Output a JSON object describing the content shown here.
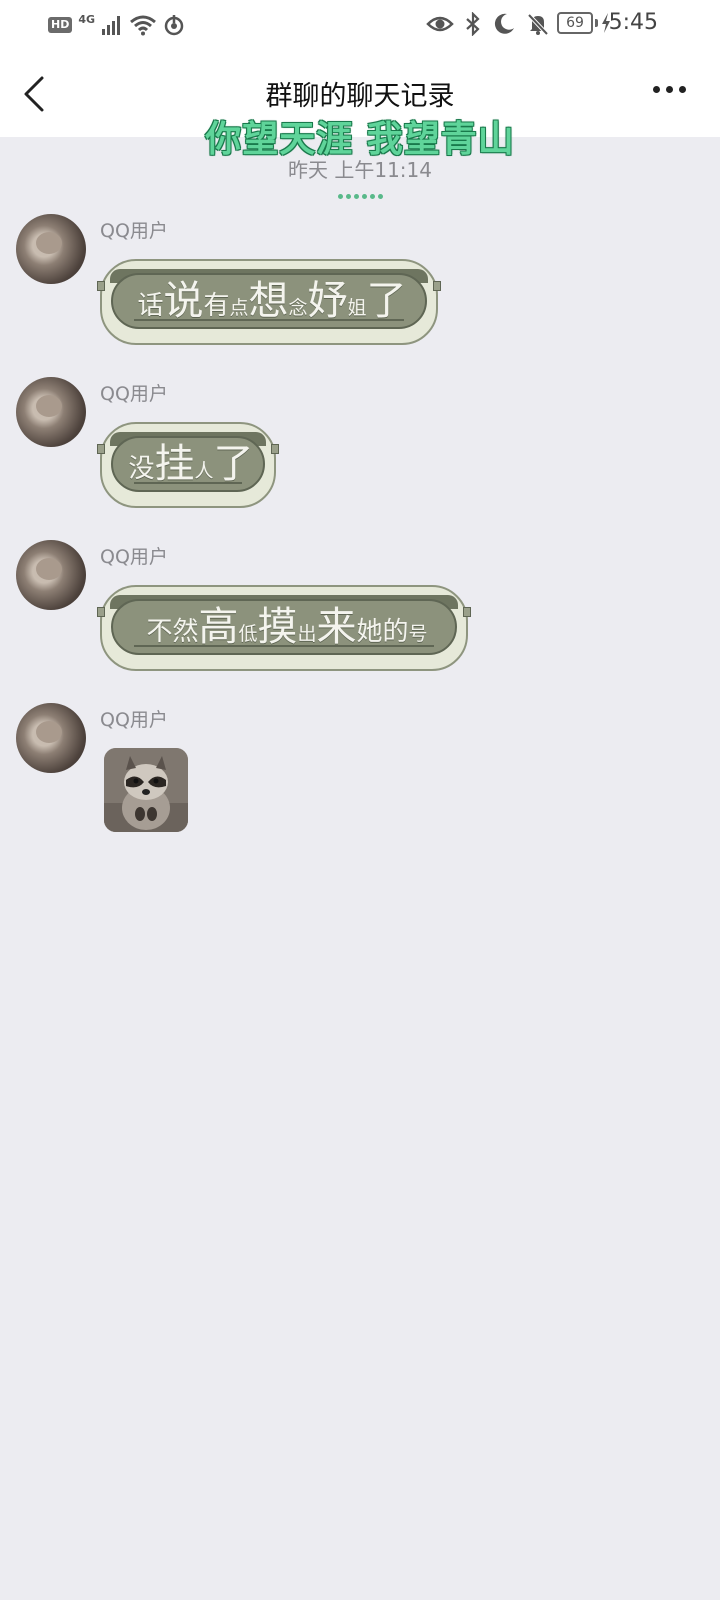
{
  "status_bar": {
    "hd": "HD",
    "network": "4G",
    "battery": "69",
    "time": "5:45"
  },
  "header": {
    "title": "群聊的聊天记录"
  },
  "overlay_banner": "你望天涯 我望青山",
  "timestamp": "昨天 上午11:14",
  "messages": [
    {
      "sender": "QQ用户",
      "sticker_text": [
        {
          "text": "话",
          "size": "md"
        },
        {
          "text": "说",
          "size": "lg"
        },
        {
          "text": "有",
          "size": "md"
        },
        {
          "text": "点",
          "size": "sm"
        },
        {
          "text": "想",
          "size": "lg"
        },
        {
          "text": "念",
          "size": "sm"
        },
        {
          "text": "妤",
          "size": "lg"
        },
        {
          "text": "姐",
          "size": "sm"
        },
        {
          "text": "了",
          "size": "lg"
        }
      ]
    },
    {
      "sender": "QQ用户",
      "sticker_text": [
        {
          "text": "没",
          "size": "md"
        },
        {
          "text": "挂",
          "size": "lg"
        },
        {
          "text": "人",
          "size": "sm"
        },
        {
          "text": "了",
          "size": "lg"
        }
      ]
    },
    {
      "sender": "QQ用户",
      "sticker_text": [
        {
          "text": "不",
          "size": "md"
        },
        {
          "text": "然",
          "size": "md"
        },
        {
          "text": "高",
          "size": "lg"
        },
        {
          "text": "低",
          "size": "sm"
        },
        {
          "text": "摸",
          "size": "lg"
        },
        {
          "text": "出",
          "size": "sm"
        },
        {
          "text": "来",
          "size": "lg"
        },
        {
          "text": "她",
          "size": "md"
        },
        {
          "text": "的",
          "size": "md"
        },
        {
          "text": "号",
          "size": "sm"
        }
      ]
    },
    {
      "sender": "QQ用户",
      "image": "raccoon-sticker"
    }
  ],
  "icons": [
    "back-arrow-icon",
    "more-icon",
    "signal-icon",
    "wifi-icon",
    "hotspot-icon",
    "eye-icon",
    "bluetooth-icon",
    "moon-icon",
    "bell-off-icon",
    "charging-icon"
  ],
  "colors": {
    "background": "#ececf1",
    "banner": "#5fd49a",
    "sticker_plank": "#8c927c"
  }
}
